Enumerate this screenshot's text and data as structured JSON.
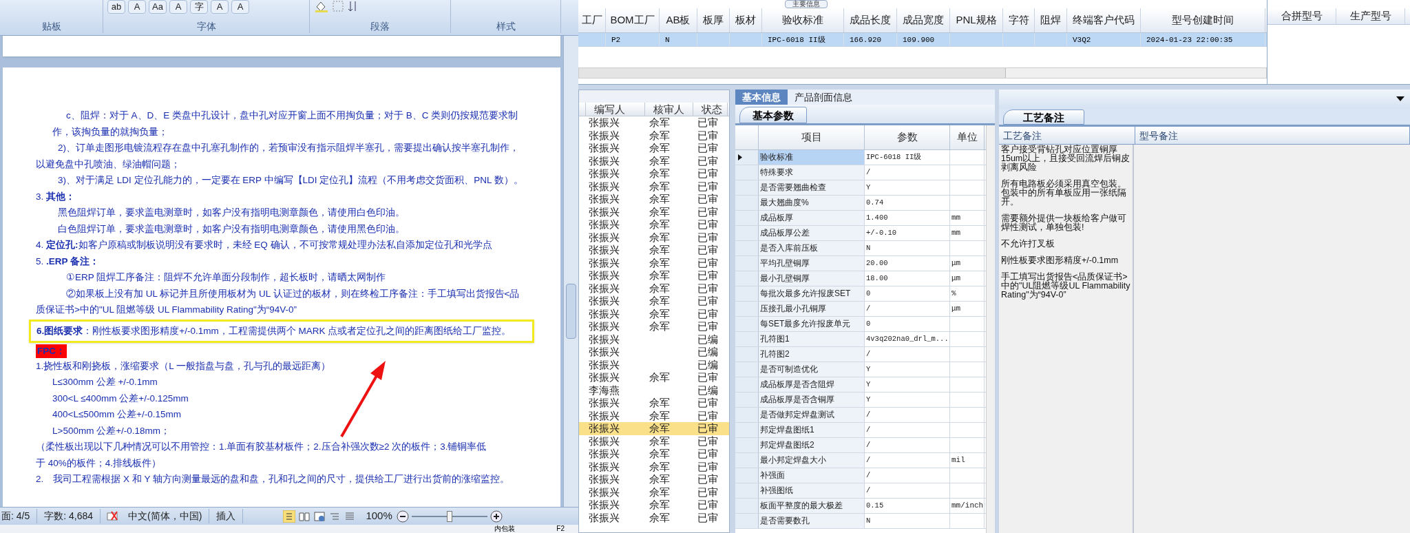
{
  "word": {
    "ribbon_buttons": [
      "ab",
      "A",
      "Aa",
      "A",
      "字",
      "A",
      "A"
    ],
    "ribbon_groups": [
      "贴板",
      "字体",
      "段落",
      "样式"
    ],
    "lines": [
      {
        "text": "c、阻焊：对于 A、D、E 类盘中孔设计，盘中孔对应开窗上面不用掏负量；对于 B、C 类则仍按规范要求制",
        "kind": "deep"
      },
      {
        "text": "作，该掏负量的就掏负量；",
        "kind": "sub"
      },
      {
        "text": "2)、订单走图形电镀流程存在盘中孔塞孔制作的，若预审没有指示阻焊半塞孔，需要提出确认按半塞孔制作，",
        "kind": "indent"
      },
      {
        "text": "以避免盘中孔喷油、绿油帽问题；",
        "kind": "flush"
      },
      {
        "text": "3)、对于满足 LDI 定位孔能力的，一定要在 ERP 中编写【LDI 定位孔】流程（不用考虑交货面积、PNL 数）。",
        "kind": "indent"
      },
      {
        "text": "3. **其他：**",
        "kind": "flush"
      },
      {
        "text": "黑色阻焊订单，要求盖电测章时，如客户没有指明电测章颜色，请使用白色印油。",
        "kind": "indent"
      },
      {
        "text": "白色阻焊订单，要求盖电测章时，如客户没有指明电测章颜色，请使用黑色印油。",
        "kind": "indent"
      },
      {
        "text": "4. **定位孔:**如客户原稿或制板说明没有要求时，未经 EQ 确认，不可按常规处理办法私自添加定位孔和光学点",
        "kind": "flush"
      },
      {
        "text": "5. **.ERP 备注：**",
        "kind": "flush"
      },
      {
        "text": "①ERP 阻焊工序备注：阻焊不允许单面分段制作，超长板时，请晒太网制作",
        "kind": "deep"
      },
      {
        "text": "②如果板上没有加 UL 标记并且所使用板材为 UL 认证过的板材，则在终检工序备注：手工填写出货报告<品",
        "kind": "deep"
      },
      {
        "text": "质保证书>中的\"UL 阻燃等级 UL Flammability Rating\"为“94V-0”",
        "kind": "flush"
      },
      {
        "text": "**6.图纸要求**：刚性板要求图形精度+/-0.1mm，工程需提供两个 MARK 点或者定位孔之间的距离图纸给工厂监控。",
        "kind": "boxed"
      },
      {
        "text": "FPC：",
        "kind": "marked"
      },
      {
        "text": "1.挠性板和刚挠板，涨缩要求（L 一般指盘与盘，孔与孔的最远距离）",
        "kind": "flush"
      },
      {
        "text": "L≤300mm 公差 +/-0.1mm",
        "kind": "sub"
      },
      {
        "text": "300<L ≤400mm 公差+/-0.125mm",
        "kind": "sub"
      },
      {
        "text": "400<L≤500mm 公差+/-0.15mm",
        "kind": "sub"
      },
      {
        "text": "L>500mm 公差+/-0.18mm；",
        "kind": "sub"
      },
      {
        "text": "（柔性板出现以下几种情况可以不用管控：1.单面有胶基材板件；2.压合补强次数≥2 次的板件；3.铺铜率低",
        "kind": "flush"
      },
      {
        "text": "于 40%的板件；4.排线板件）",
        "kind": "flush"
      },
      {
        "text": "2.　我司工程需根据 X 和 Y 轴方向测量最远的盘和盘，孔和孔之间的尺寸，提供给工厂进行出货前的涨缩监控。",
        "kind": "flush"
      }
    ],
    "status_bar": {
      "page": "面: 4/5",
      "words": "字数: 4,684",
      "language": "中文(简体，中国)",
      "mode": "插入",
      "zoom": "100%",
      "zoom_slider": {
        "level": 0.5
      }
    }
  },
  "background_strip": [
    "内包装",
    "F2"
  ],
  "top_tab": "主要信息",
  "main_grid": {
    "columns": [
      "工厂",
      "BOM工厂",
      "AB板",
      "板厚",
      "板材",
      "验收标准",
      "成品长度",
      "成品宽度",
      "PNL规格",
      "字符",
      "阻焊",
      "终端客户代码",
      "型号创建时间"
    ],
    "rows": [
      {
        "cells": [
          "",
          "P2",
          "N",
          "",
          "",
          "IPC-6018 II级",
          "166.920",
          "109.900",
          "",
          "",
          "",
          "V3Q2",
          "2024-01-23 22:00:35"
        ],
        "selected": true
      }
    ]
  },
  "merge_grid": {
    "columns": [
      "合拼型号",
      "生产型号"
    ]
  },
  "list": {
    "columns": [
      "编写人",
      "核审人",
      "状态"
    ],
    "rows": [
      {
        "writer": "张振兴",
        "reviewer": "佘军",
        "status": "已审",
        "selected": false
      },
      {
        "writer": "张振兴",
        "reviewer": "佘军",
        "status": "已审",
        "selected": false
      },
      {
        "writer": "张振兴",
        "reviewer": "佘军",
        "status": "已审",
        "selected": false
      },
      {
        "writer": "张振兴",
        "reviewer": "佘军",
        "status": "已审",
        "selected": false
      },
      {
        "writer": "张振兴",
        "reviewer": "佘军",
        "status": "已审",
        "selected": false
      },
      {
        "writer": "张振兴",
        "reviewer": "佘军",
        "status": "已审",
        "selected": false
      },
      {
        "writer": "张振兴",
        "reviewer": "佘军",
        "status": "已审",
        "selected": false
      },
      {
        "writer": "张振兴",
        "reviewer": "佘军",
        "status": "已审",
        "selected": false
      },
      {
        "writer": "张振兴",
        "reviewer": "佘军",
        "status": "已审",
        "selected": false
      },
      {
        "writer": "张振兴",
        "reviewer": "佘军",
        "status": "已审",
        "selected": false
      },
      {
        "writer": "张振兴",
        "reviewer": "佘军",
        "status": "已审",
        "selected": false
      },
      {
        "writer": "张振兴",
        "reviewer": "佘军",
        "status": "已审",
        "selected": false
      },
      {
        "writer": "张振兴",
        "reviewer": "佘军",
        "status": "已审",
        "selected": false
      },
      {
        "writer": "张振兴",
        "reviewer": "佘军",
        "status": "已审",
        "selected": false
      },
      {
        "writer": "张振兴",
        "reviewer": "佘军",
        "status": "已审",
        "selected": false
      },
      {
        "writer": "张振兴",
        "reviewer": "佘军",
        "status": "已审",
        "selected": false
      },
      {
        "writer": "张振兴",
        "reviewer": "佘军",
        "status": "已审",
        "selected": false
      },
      {
        "writer": "张振兴",
        "reviewer": "",
        "status": "已编",
        "selected": false
      },
      {
        "writer": "张振兴",
        "reviewer": "",
        "status": "已编",
        "selected": false
      },
      {
        "writer": "张振兴",
        "reviewer": "",
        "status": "已编",
        "selected": false
      },
      {
        "writer": "张振兴",
        "reviewer": "佘军",
        "status": "已审",
        "selected": false
      },
      {
        "writer": "李海燕",
        "reviewer": "",
        "status": "已编",
        "selected": false
      },
      {
        "writer": "张振兴",
        "reviewer": "佘军",
        "status": "已审",
        "selected": false
      },
      {
        "writer": "张振兴",
        "reviewer": "佘军",
        "status": "已审",
        "selected": false
      },
      {
        "writer": "张振兴",
        "reviewer": "佘军",
        "status": "已审",
        "selected": true
      },
      {
        "writer": "张振兴",
        "reviewer": "佘军",
        "status": "已审",
        "selected": false
      },
      {
        "writer": "张振兴",
        "reviewer": "佘军",
        "status": "已审",
        "selected": false
      },
      {
        "writer": "张振兴",
        "reviewer": "佘军",
        "status": "已审",
        "selected": false
      },
      {
        "writer": "张振兴",
        "reviewer": "佘军",
        "status": "已审",
        "selected": false
      },
      {
        "writer": "张振兴",
        "reviewer": "佘军",
        "status": "已审",
        "selected": false
      },
      {
        "writer": "张振兴",
        "reviewer": "佘军",
        "status": "已审",
        "selected": false
      },
      {
        "writer": "张振兴",
        "reviewer": "佘军",
        "status": "已审",
        "selected": false
      }
    ]
  },
  "detail": {
    "tabs": [
      {
        "label": "基本信息",
        "selected": true
      },
      {
        "label": "产品剖面信息",
        "selected": false
      }
    ],
    "subtab": "基本参数",
    "columns": [
      "项目",
      "参数",
      "单位"
    ],
    "rows": [
      {
        "item": "验收标准",
        "value": "IPC-6018 II级",
        "unit": "",
        "selected": true
      },
      {
        "item": "特殊要求",
        "value": "/",
        "unit": "",
        "selected": false
      },
      {
        "item": "是否需要翘曲检查",
        "value": "Y",
        "unit": "",
        "selected": false
      },
      {
        "item": "最大翘曲度%",
        "value": "0.74",
        "unit": "",
        "selected": false
      },
      {
        "item": "成品板厚",
        "value": "1.400",
        "unit": "mm",
        "selected": false
      },
      {
        "item": "成品板厚公差",
        "value": "+/-0.10",
        "unit": "mm",
        "selected": false
      },
      {
        "item": "是否入库前压板",
        "value": "N",
        "unit": "",
        "selected": false
      },
      {
        "item": "平均孔壁铜厚",
        "value": "20.00",
        "unit": "μm",
        "selected": false
      },
      {
        "item": "最小孔壁铜厚",
        "value": "18.00",
        "unit": "μm",
        "selected": false
      },
      {
        "item": "每批次最多允许报废SET",
        "value": "0",
        "unit": "%",
        "selected": false
      },
      {
        "item": "压接孔最小孔铜厚",
        "value": "/",
        "unit": "μm",
        "selected": false
      },
      {
        "item": "每SET最多允许报废单元",
        "value": "0",
        "unit": "",
        "selected": false
      },
      {
        "item": "孔符图1",
        "value": "4v3q202na0_drl_m...",
        "unit": "",
        "selected": false
      },
      {
        "item": "孔符图2",
        "value": "/",
        "unit": "",
        "selected": false
      },
      {
        "item": "是否可制造优化",
        "value": "Y",
        "unit": "",
        "selected": false
      },
      {
        "item": "成品板厚是否含阻焊",
        "value": "Y",
        "unit": "",
        "selected": false
      },
      {
        "item": "成品板厚是否含铜厚",
        "value": "Y",
        "unit": "",
        "selected": false
      },
      {
        "item": "是否做邦定焊盘测试",
        "value": "/",
        "unit": "",
        "selected": false
      },
      {
        "item": "邦定焊盘图纸1",
        "value": "/",
        "unit": "",
        "selected": false
      },
      {
        "item": "邦定焊盘图纸2",
        "value": "/",
        "unit": "",
        "selected": false
      },
      {
        "item": "最小邦定焊盘大小",
        "value": "/",
        "unit": "mil",
        "selected": false
      },
      {
        "item": "补强面",
        "value": "/",
        "unit": "",
        "selected": false
      },
      {
        "item": "补强图纸",
        "value": "/",
        "unit": "",
        "selected": false
      },
      {
        "item": "板面平整度的最大极差",
        "value": "0.15",
        "unit": "mm/inch",
        "selected": false
      },
      {
        "item": "是否需要数孔",
        "value": "N",
        "unit": "",
        "selected": false
      }
    ]
  },
  "notes": {
    "tab": "工艺备注",
    "columns": [
      "工艺备注",
      "型号备注"
    ],
    "process_notes": [
      "客户接受背钻孔对应位置铜厚15um以上，且接受回流焊后铜皮剥离风险",
      "所有电路板必须采用真空包装。包装中的所有单板应用一张纸隔开。",
      "需要额外提供一块板给客户做可焊性测试，单独包装!",
      "不允许打叉板",
      "刚性板要求图形精度+/-0.1mm",
      "手工填写出货报告<品质保证书>中的\"UL阻燃等级UL Flammability Rating\"为“94V-0”"
    ]
  }
}
